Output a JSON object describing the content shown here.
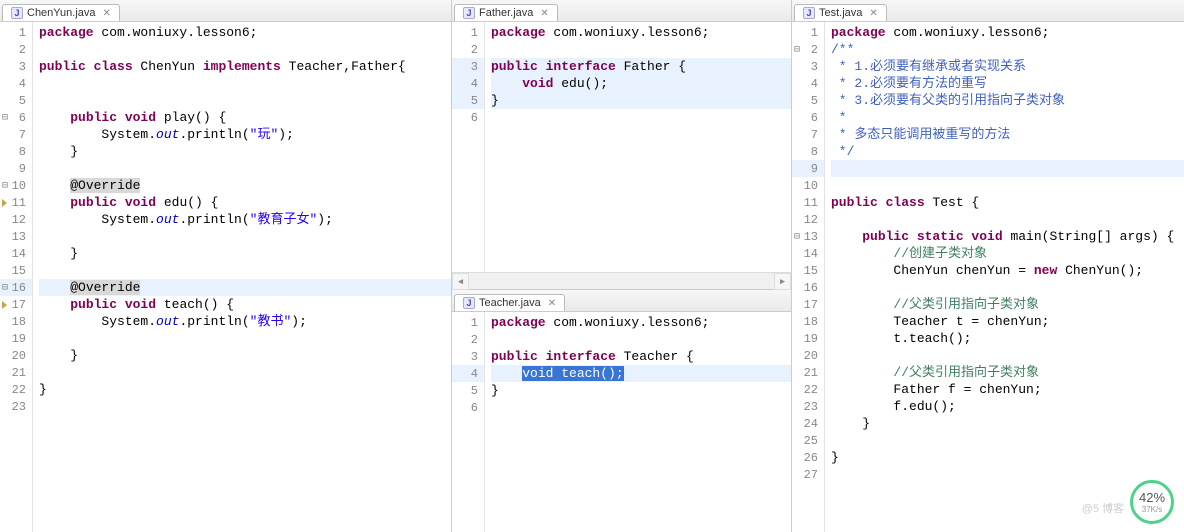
{
  "tabs": {
    "chenyun": "ChenYun.java",
    "father": "Father.java",
    "teacher": "Teacher.java",
    "test": "Test.java"
  },
  "icon_letter": "J",
  "close_glyph": "✕",
  "chenyun": {
    "lines": [
      {
        "n": "1",
        "tokens": [
          {
            "t": "package ",
            "c": "kw"
          },
          {
            "t": "com.woniuxy.lesson6;"
          }
        ]
      },
      {
        "n": "2",
        "tokens": []
      },
      {
        "n": "3",
        "tokens": [
          {
            "t": "public class ",
            "c": "kw"
          },
          {
            "t": "ChenYun "
          },
          {
            "t": "implements ",
            "c": "kw"
          },
          {
            "t": "Teacher,Father{"
          }
        ]
      },
      {
        "n": "4",
        "tokens": []
      },
      {
        "n": "5",
        "tokens": []
      },
      {
        "n": "6",
        "fold": "⊟",
        "tokens": [
          {
            "t": "    "
          },
          {
            "t": "public void ",
            "c": "kw"
          },
          {
            "t": "play() {"
          }
        ]
      },
      {
        "n": "7",
        "tokens": [
          {
            "t": "        System."
          },
          {
            "t": "out",
            "c": "fld"
          },
          {
            "t": ".println("
          },
          {
            "t": "\"玩\"",
            "c": "str"
          },
          {
            "t": ");"
          }
        ]
      },
      {
        "n": "8",
        "tokens": [
          {
            "t": "    }"
          }
        ]
      },
      {
        "n": "9",
        "tokens": []
      },
      {
        "n": "10",
        "fold": "⊟",
        "tokens": [
          {
            "t": "    "
          },
          {
            "t": "@Override",
            "c": "",
            "bg": "hl-gray"
          }
        ]
      },
      {
        "n": "11",
        "marker": true,
        "tokens": [
          {
            "t": "    "
          },
          {
            "t": "public void ",
            "c": "kw"
          },
          {
            "t": "edu() {"
          }
        ]
      },
      {
        "n": "12",
        "tokens": [
          {
            "t": "        System."
          },
          {
            "t": "out",
            "c": "fld"
          },
          {
            "t": ".println("
          },
          {
            "t": "\"教育子女\"",
            "c": "str"
          },
          {
            "t": ");"
          }
        ]
      },
      {
        "n": "13",
        "tokens": []
      },
      {
        "n": "14",
        "tokens": [
          {
            "t": "    }"
          }
        ]
      },
      {
        "n": "15",
        "tokens": []
      },
      {
        "n": "16",
        "fold": "⊟",
        "hl": true,
        "tokens": [
          {
            "t": "    "
          },
          {
            "t": "@Override",
            "c": "",
            "bg": "hl-gray"
          }
        ]
      },
      {
        "n": "17",
        "marker": true,
        "tokens": [
          {
            "t": "    "
          },
          {
            "t": "public void ",
            "c": "kw"
          },
          {
            "t": "teach() {"
          }
        ]
      },
      {
        "n": "18",
        "tokens": [
          {
            "t": "        System."
          },
          {
            "t": "out",
            "c": "fld"
          },
          {
            "t": ".println("
          },
          {
            "t": "\"教书\"",
            "c": "str"
          },
          {
            "t": ");"
          }
        ]
      },
      {
        "n": "19",
        "tokens": []
      },
      {
        "n": "20",
        "tokens": [
          {
            "t": "    }"
          }
        ]
      },
      {
        "n": "21",
        "tokens": []
      },
      {
        "n": "22",
        "tokens": [
          {
            "t": "}"
          }
        ]
      },
      {
        "n": "23",
        "tokens": []
      }
    ]
  },
  "father": {
    "lines": [
      {
        "n": "1",
        "tokens": [
          {
            "t": "package ",
            "c": "kw"
          },
          {
            "t": "com.woniuxy.lesson6;"
          }
        ]
      },
      {
        "n": "2",
        "tokens": []
      },
      {
        "n": "3",
        "hl": true,
        "tokens": [
          {
            "t": "public interface ",
            "c": "kw"
          },
          {
            "t": "Father {"
          }
        ]
      },
      {
        "n": "4",
        "hl": true,
        "tokens": [
          {
            "t": "    "
          },
          {
            "t": "void ",
            "c": "kw"
          },
          {
            "t": "edu();"
          }
        ]
      },
      {
        "n": "5",
        "hl": true,
        "tokens": [
          {
            "t": "}"
          }
        ]
      },
      {
        "n": "6",
        "tokens": []
      }
    ]
  },
  "teacher": {
    "lines": [
      {
        "n": "1",
        "tokens": [
          {
            "t": "package ",
            "c": "kw"
          },
          {
            "t": "com.woniuxy.lesson6;"
          }
        ]
      },
      {
        "n": "2",
        "tokens": []
      },
      {
        "n": "3",
        "tokens": [
          {
            "t": "public interface ",
            "c": "kw"
          },
          {
            "t": "Teacher {"
          }
        ]
      },
      {
        "n": "4",
        "hl": true,
        "tokens": [
          {
            "t": "    "
          },
          {
            "t": "void teach();",
            "c": "",
            "bg": "hl-sel"
          }
        ]
      },
      {
        "n": "5",
        "tokens": [
          {
            "t": "}"
          }
        ]
      },
      {
        "n": "6",
        "tokens": []
      }
    ]
  },
  "test": {
    "lines": [
      {
        "n": "1",
        "tokens": [
          {
            "t": "package ",
            "c": "kw"
          },
          {
            "t": "com.woniuxy.lesson6;"
          }
        ]
      },
      {
        "n": "2",
        "fold": "⊟",
        "tokens": [
          {
            "t": "/**",
            "c": "doc"
          }
        ]
      },
      {
        "n": "3",
        "tokens": [
          {
            "t": " * 1.必须要有继承或者实现关系",
            "c": "doc"
          }
        ]
      },
      {
        "n": "4",
        "tokens": [
          {
            "t": " * 2.必须要有方法的重写",
            "c": "doc"
          }
        ]
      },
      {
        "n": "5",
        "tokens": [
          {
            "t": " * 3.必须要有父类的引用指向子类对象",
            "c": "doc"
          }
        ]
      },
      {
        "n": "6",
        "tokens": [
          {
            "t": " *",
            "c": "doc"
          }
        ]
      },
      {
        "n": "7",
        "tokens": [
          {
            "t": " * 多态只能调用被重写的方法",
            "c": "doc"
          }
        ]
      },
      {
        "n": "8",
        "tokens": [
          {
            "t": " */",
            "c": "doc"
          }
        ]
      },
      {
        "n": "9",
        "hl": true,
        "tokens": []
      },
      {
        "n": "10",
        "tokens": []
      },
      {
        "n": "11",
        "tokens": [
          {
            "t": "public class ",
            "c": "kw"
          },
          {
            "t": "Test {"
          }
        ]
      },
      {
        "n": "12",
        "tokens": []
      },
      {
        "n": "13",
        "fold": "⊟",
        "tokens": [
          {
            "t": "    "
          },
          {
            "t": "public static void ",
            "c": "kw"
          },
          {
            "t": "main(String[] args) {"
          }
        ]
      },
      {
        "n": "14",
        "tokens": [
          {
            "t": "        "
          },
          {
            "t": "//创建子类对象",
            "c": "cmt"
          }
        ]
      },
      {
        "n": "15",
        "tokens": [
          {
            "t": "        ChenYun chenYun = "
          },
          {
            "t": "new ",
            "c": "kw"
          },
          {
            "t": "ChenYun();"
          }
        ]
      },
      {
        "n": "16",
        "tokens": []
      },
      {
        "n": "17",
        "tokens": [
          {
            "t": "        "
          },
          {
            "t": "//父类引用指向子类对象",
            "c": "cmt"
          }
        ]
      },
      {
        "n": "18",
        "tokens": [
          {
            "t": "        Teacher t = chenYun;"
          }
        ]
      },
      {
        "n": "19",
        "tokens": [
          {
            "t": "        t.teach();"
          }
        ]
      },
      {
        "n": "20",
        "tokens": []
      },
      {
        "n": "21",
        "tokens": [
          {
            "t": "        "
          },
          {
            "t": "//父类引用指向子类对象",
            "c": "cmt"
          }
        ]
      },
      {
        "n": "22",
        "tokens": [
          {
            "t": "        Father f = chenYun;"
          }
        ]
      },
      {
        "n": "23",
        "tokens": [
          {
            "t": "        f.edu();"
          }
        ]
      },
      {
        "n": "24",
        "tokens": [
          {
            "t": "    }"
          }
        ]
      },
      {
        "n": "25",
        "tokens": []
      },
      {
        "n": "26",
        "tokens": [
          {
            "t": "}"
          }
        ]
      },
      {
        "n": "27",
        "tokens": []
      }
    ]
  },
  "watermark": {
    "percent": "42%",
    "speed": "37K/s"
  },
  "faded": "@5 博客"
}
